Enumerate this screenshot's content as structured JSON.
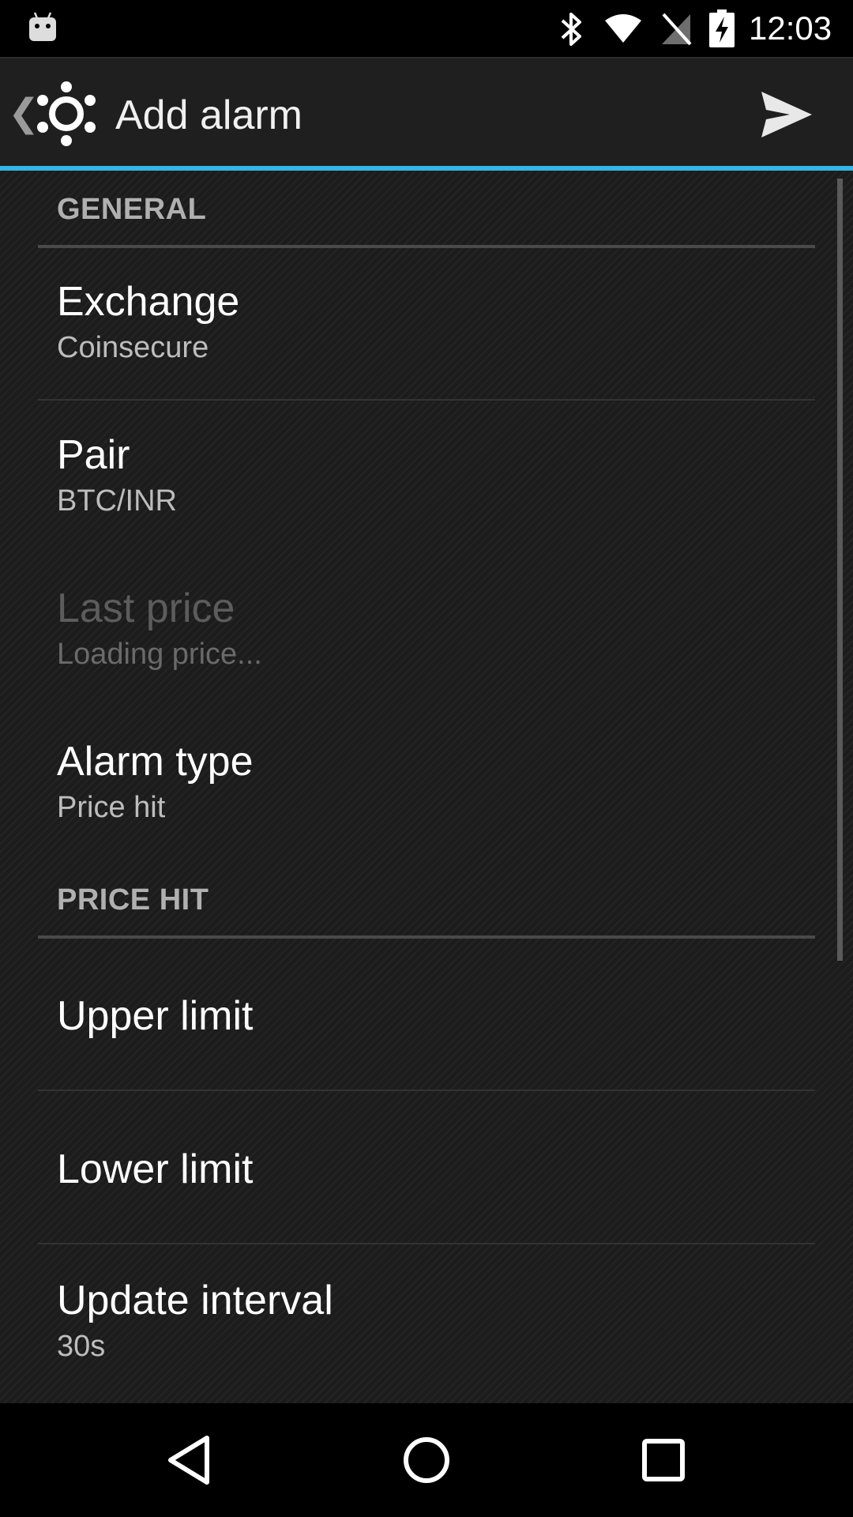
{
  "status_bar": {
    "time": "12:03",
    "icons": [
      "android-icon",
      "bluetooth-icon",
      "wifi-icon",
      "no-signal-icon",
      "battery-charging-icon"
    ]
  },
  "action_bar": {
    "title": "Add alarm",
    "up_icon": "chevron-left-icon",
    "logo_icon": "app-logo-icon",
    "action_icon": "send-icon",
    "accent_color": "#33b5e5"
  },
  "sections": {
    "general": {
      "header": "GENERAL",
      "exchange": {
        "title": "Exchange",
        "summary": "Coinsecure"
      },
      "pair": {
        "title": "Pair",
        "summary": "BTC/INR"
      },
      "last_price": {
        "title": "Last price",
        "summary": "Loading price...",
        "enabled": false
      },
      "alarm_type": {
        "title": "Alarm type",
        "summary": "Price hit"
      }
    },
    "price_hit": {
      "header": "PRICE HIT",
      "upper_limit": {
        "title": "Upper limit"
      },
      "lower_limit": {
        "title": "Lower limit"
      },
      "update_interval": {
        "title": "Update interval",
        "summary": "30s"
      }
    }
  },
  "nav_bar": {
    "icons": [
      "back-icon",
      "home-icon",
      "recents-icon"
    ]
  }
}
